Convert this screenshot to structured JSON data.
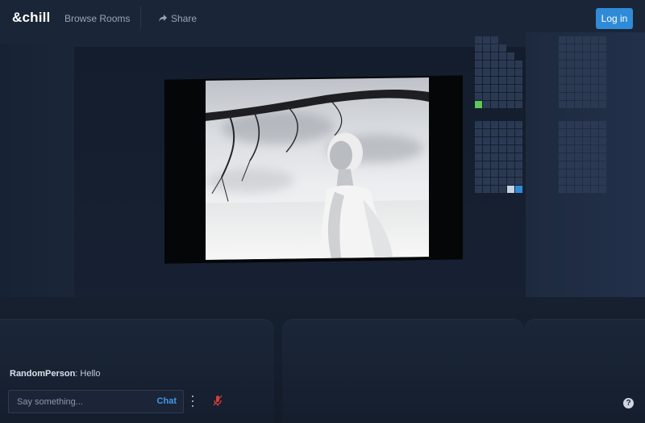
{
  "brand": {
    "logo": "&chill"
  },
  "nav": {
    "browse_label": "Browse Rooms",
    "share_label": "Share"
  },
  "auth": {
    "login_label": "Log in"
  },
  "chat": {
    "message": {
      "user": "RandomPerson",
      "text": "Hello"
    },
    "input_placeholder": "Say something...",
    "send_label": "Chat"
  },
  "colors": {
    "accent": "#2f8bd8",
    "seat_empty": "#2b3a52",
    "seat_user_green": "#5cc85a",
    "seat_user_light": "#c7d3e0",
    "seat_user_blue": "#2f8bd8",
    "mute_red": "#d23b3b"
  },
  "icons": [
    "share-icon",
    "more-options-icon",
    "mic-muted-icon",
    "help-icon"
  ],
  "seating": {
    "blocks": [
      {
        "id": "top-left",
        "layout": "triangle",
        "occupied": [
          {
            "row": 8,
            "col": 0,
            "color": "seat_user_green"
          }
        ]
      },
      {
        "id": "top-right",
        "layout": "full",
        "occupied": []
      },
      {
        "id": "bottom-left",
        "layout": "full",
        "occupied": [
          {
            "row": 8,
            "col": 4,
            "color": "seat_user_light"
          },
          {
            "row": 8,
            "col": 5,
            "color": "seat_user_blue"
          }
        ]
      },
      {
        "id": "bottom-right",
        "layout": "full",
        "occupied": []
      }
    ]
  }
}
